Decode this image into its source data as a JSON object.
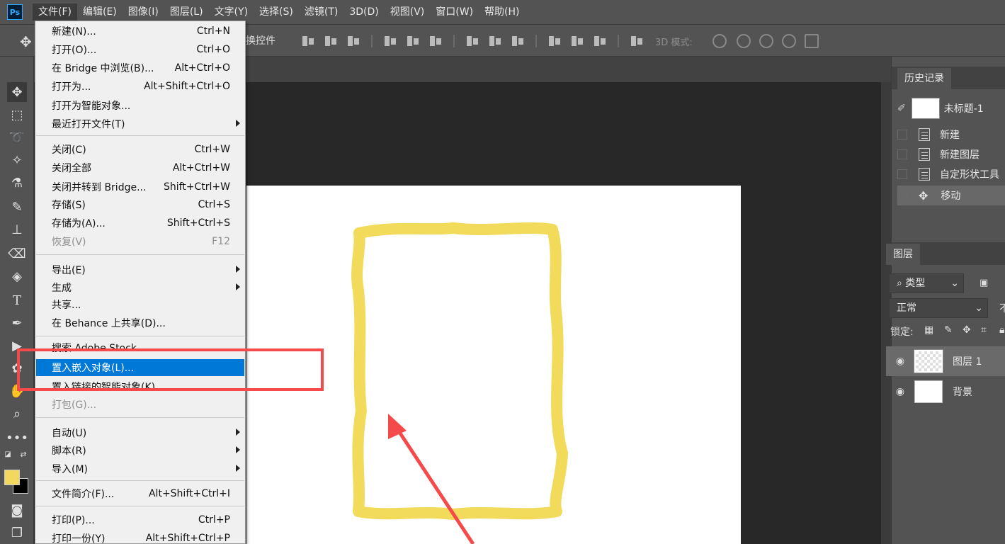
{
  "menubar": {
    "logo": "Ps",
    "items": [
      "文件(F)",
      "编辑(E)",
      "图像(I)",
      "图层(L)",
      "文字(Y)",
      "选择(S)",
      "滤镜(T)",
      "3D(D)",
      "视图(V)",
      "窗口(W)",
      "帮助(H)"
    ]
  },
  "options_bar": {
    "transform_controls_label": "换控件",
    "mode_3d_label": "3D 模式:"
  },
  "file_menu": {
    "groups": [
      [
        {
          "label": "新建(N)...",
          "shortcut": "Ctrl+N"
        },
        {
          "label": "打开(O)...",
          "shortcut": "Ctrl+O"
        },
        {
          "label": "在 Bridge 中浏览(B)...",
          "shortcut": "Alt+Ctrl+O"
        },
        {
          "label": "打开为...",
          "shortcut": "Alt+Shift+Ctrl+O"
        },
        {
          "label": "打开为智能对象...",
          "shortcut": ""
        },
        {
          "label": "最近打开文件(T)",
          "shortcut": "",
          "submenu": true
        }
      ],
      [
        {
          "label": "关闭(C)",
          "shortcut": "Ctrl+W"
        },
        {
          "label": "关闭全部",
          "shortcut": "Alt+Ctrl+W"
        },
        {
          "label": "关闭并转到 Bridge...",
          "shortcut": "Shift+Ctrl+W"
        },
        {
          "label": "存储(S)",
          "shortcut": "Ctrl+S"
        },
        {
          "label": "存储为(A)...",
          "shortcut": "Shift+Ctrl+S"
        },
        {
          "label": "恢复(V)",
          "shortcut": "F12",
          "disabled": true
        }
      ],
      [
        {
          "label": "导出(E)",
          "shortcut": "",
          "submenu": true
        },
        {
          "label": "生成",
          "shortcut": "",
          "submenu": true
        },
        {
          "label": "共享...",
          "shortcut": ""
        },
        {
          "label": "在 Behance 上共享(D)...",
          "shortcut": ""
        }
      ],
      [
        {
          "label": "搜索 Adobe Stock...",
          "shortcut": ""
        },
        {
          "label": "置入嵌入对象(L)...",
          "shortcut": "",
          "highlighted": true
        },
        {
          "label": "置入链接的智能对象(K)...",
          "shortcut": ""
        },
        {
          "label": "打包(G)...",
          "shortcut": "",
          "disabled": true
        }
      ],
      [
        {
          "label": "自动(U)",
          "shortcut": "",
          "submenu": true
        },
        {
          "label": "脚本(R)",
          "shortcut": "",
          "submenu": true
        },
        {
          "label": "导入(M)",
          "shortcut": "",
          "submenu": true
        }
      ],
      [
        {
          "label": "文件简介(F)...",
          "shortcut": "Alt+Shift+Ctrl+I"
        }
      ],
      [
        {
          "label": "打印(P)...",
          "shortcut": "Ctrl+P"
        },
        {
          "label": "打印一份(Y)",
          "shortcut": "Alt+Shift+Ctrl+P"
        }
      ]
    ]
  },
  "history_panel": {
    "tab": "历史记录",
    "snapshot": "未标题-1",
    "steps": [
      "新建",
      "新建图层",
      "自定形状工具",
      "移动"
    ],
    "selected_step": "移动"
  },
  "layers_panel": {
    "tab": "图层",
    "filter_kind": "类型",
    "blend_mode": "正常",
    "opacity_label": "不",
    "lock_label": "锁定:",
    "layers": [
      {
        "name": "图层 1",
        "visible": true,
        "selected": true
      },
      {
        "name": "背景",
        "visible": true,
        "selected": false
      }
    ]
  },
  "colors": {
    "foreground": "#f2d85c",
    "background": "#000000",
    "menu_highlight": "#0078d7",
    "annotation_red": "#f44a4a",
    "shape_stroke": "#f2da5a"
  }
}
